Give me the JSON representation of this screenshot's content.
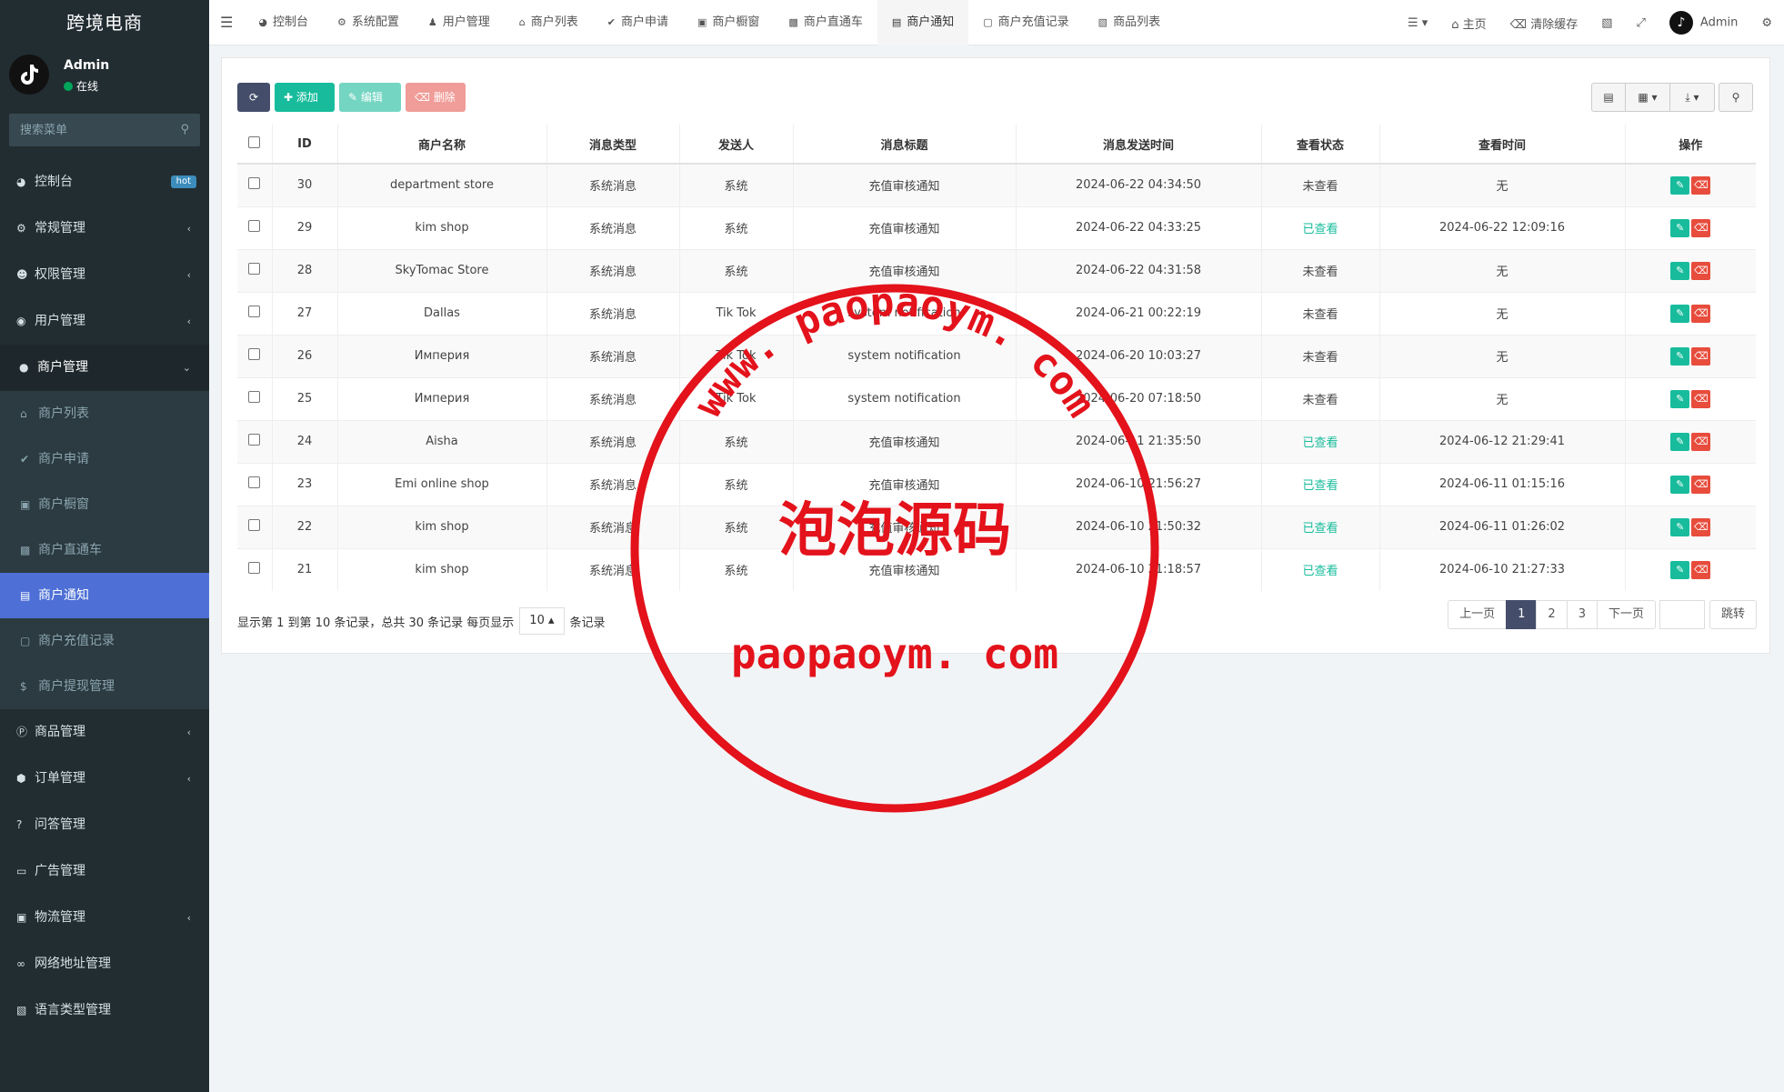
{
  "brand": "跨境电商",
  "user": {
    "name": "Admin",
    "status": "在线",
    "avatar_icon": "tiktok-icon"
  },
  "sidebar": {
    "search_placeholder": "搜索菜单",
    "items": [
      {
        "label": "控制台",
        "icon": "dashboard-icon",
        "badge": "hot"
      },
      {
        "label": "常规管理",
        "icon": "cogs-icon"
      },
      {
        "label": "权限管理",
        "icon": "group-icon"
      },
      {
        "label": "用户管理",
        "icon": "user-circle-icon"
      },
      {
        "label": "商户管理",
        "icon": "apple-icon"
      },
      {
        "label": "商品管理",
        "icon": "product-icon"
      },
      {
        "label": "订单管理",
        "icon": "cube-icon"
      },
      {
        "label": "问答管理",
        "icon": "question-icon"
      },
      {
        "label": "广告管理",
        "icon": "ad-icon"
      },
      {
        "label": "物流管理",
        "icon": "truck-icon"
      },
      {
        "label": "网络地址管理",
        "icon": "link-icon"
      },
      {
        "label": "语言类型管理",
        "icon": "language-icon"
      }
    ],
    "sub_items": [
      {
        "label": "商户列表",
        "icon": "home-icon"
      },
      {
        "label": "商户申请",
        "icon": "check-circle-icon"
      },
      {
        "label": "商户橱窗",
        "icon": "cart-icon"
      },
      {
        "label": "商户直通车",
        "icon": "car-icon"
      },
      {
        "label": "商户通知",
        "icon": "notice-icon"
      },
      {
        "label": "商户充值记录",
        "icon": "money-icon"
      },
      {
        "label": "商户提现管理",
        "icon": "dollar-icon"
      }
    ]
  },
  "tabs": [
    "控制台",
    "系统配置",
    "用户管理",
    "商户列表",
    "商户申请",
    "商户橱窗",
    "商户直通车",
    "商户通知",
    "商户充值记录",
    "商品列表"
  ],
  "topright": {
    "home": "主页",
    "clear_cache": "清除缓存",
    "admin": "Admin"
  },
  "toolbar": {
    "add": "添加",
    "edit": "编辑",
    "delete": "删除"
  },
  "table": {
    "headers": [
      "ID",
      "商户名称",
      "消息类型",
      "发送人",
      "消息标题",
      "消息发送时间",
      "查看状态",
      "查看时间",
      "操作"
    ],
    "rows": [
      {
        "id": "30",
        "name": "department store",
        "type": "系统消息",
        "sender": "系统",
        "title": "充值审核通知",
        "sent": "2024-06-22 04:34:50",
        "status": "未查看",
        "seen": false,
        "view_time": "无"
      },
      {
        "id": "29",
        "name": "kim shop",
        "type": "系统消息",
        "sender": "系统",
        "title": "充值审核通知",
        "sent": "2024-06-22 04:33:25",
        "status": "已查看",
        "seen": true,
        "view_time": "2024-06-22 12:09:16"
      },
      {
        "id": "28",
        "name": "SkyTomac Store",
        "type": "系统消息",
        "sender": "系统",
        "title": "充值审核通知",
        "sent": "2024-06-22 04:31:58",
        "status": "未查看",
        "seen": false,
        "view_time": "无"
      },
      {
        "id": "27",
        "name": "Dallas",
        "type": "系统消息",
        "sender": "Tik Tok",
        "title": "system notification",
        "sent": "2024-06-21 00:22:19",
        "status": "未查看",
        "seen": false,
        "view_time": "无"
      },
      {
        "id": "26",
        "name": "Империя",
        "type": "系统消息",
        "sender": "Tik Tok",
        "title": "system notification",
        "sent": "2024-06-20 10:03:27",
        "status": "未查看",
        "seen": false,
        "view_time": "无"
      },
      {
        "id": "25",
        "name": "Империя",
        "type": "系统消息",
        "sender": "Tik Tok",
        "title": "system notification",
        "sent": "2024-06-20 07:18:50",
        "status": "未查看",
        "seen": false,
        "view_time": "无"
      },
      {
        "id": "24",
        "name": "Aisha",
        "type": "系统消息",
        "sender": "系统",
        "title": "充值审核通知",
        "sent": "2024-06-11 21:35:50",
        "status": "已查看",
        "seen": true,
        "view_time": "2024-06-12 21:29:41"
      },
      {
        "id": "23",
        "name": "Emi online shop",
        "type": "系统消息",
        "sender": "系统",
        "title": "充值审核通知",
        "sent": "2024-06-10 21:56:27",
        "status": "已查看",
        "seen": true,
        "view_time": "2024-06-11 01:15:16"
      },
      {
        "id": "22",
        "name": "kim shop",
        "type": "系统消息",
        "sender": "系统",
        "title": "充值审核通知",
        "sent": "2024-06-10 21:50:32",
        "status": "已查看",
        "seen": true,
        "view_time": "2024-06-11 01:26:02"
      },
      {
        "id": "21",
        "name": "kim shop",
        "type": "系统消息",
        "sender": "系统",
        "title": "充值审核通知",
        "sent": "2024-06-10 21:18:57",
        "status": "已查看",
        "seen": true,
        "view_time": "2024-06-10 21:27:33"
      }
    ]
  },
  "pagination": {
    "info": "显示第 1 到第 10 条记录，总共 30 条记录 每页显示",
    "page_size": "10",
    "suffix": "条记录",
    "prev": "上一页",
    "pages": [
      "1",
      "2",
      "3"
    ],
    "next": "下一页",
    "go": "跳转"
  },
  "watermark": {
    "top_text": "www. paopaoym. com",
    "middle_text": "泡泡源码",
    "bottom_text": "paopaoym. com",
    "color": "#e3121b"
  },
  "colors": {
    "sidebar_bg": "#222d32",
    "active_menu": "#4d6fd6",
    "success": "#18bc9c",
    "danger": "#e74c3c",
    "primary_dark": "#444e6a"
  }
}
